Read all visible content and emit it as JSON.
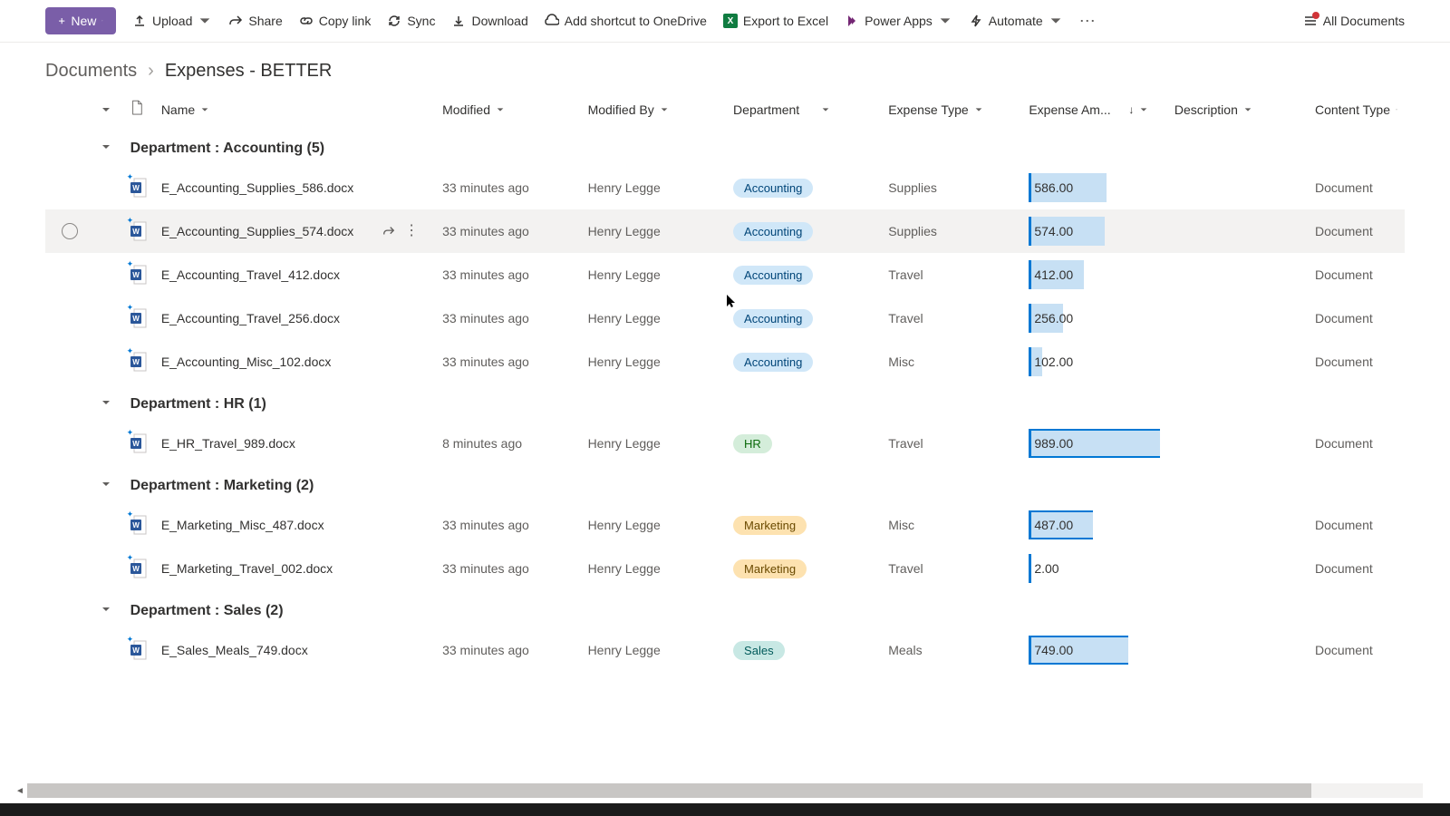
{
  "toolbar": {
    "new": "New",
    "upload": "Upload",
    "share": "Share",
    "copylink": "Copy link",
    "sync": "Sync",
    "download": "Download",
    "shortcut": "Add shortcut to OneDrive",
    "export": "Export to Excel",
    "powerapps": "Power Apps",
    "automate": "Automate",
    "alldocs": "All Documents"
  },
  "breadcrumb": {
    "root": "Documents",
    "current": "Expenses - BETTER"
  },
  "columns": {
    "name": "Name",
    "modified": "Modified",
    "modifiedby": "Modified By",
    "department": "Department",
    "exptype": "Expense Type",
    "amount": "Expense Am...",
    "description": "Description",
    "contenttype": "Content Type"
  },
  "groups": [
    {
      "label": "Department : Accounting (5)",
      "pillClass": "pill-acc",
      "items": [
        {
          "name": "E_Accounting_Supplies_586.docx",
          "modified": "33 minutes ago",
          "modby": "Henry Legge",
          "dept": "Accounting",
          "type": "Supplies",
          "amt": "586.00",
          "bar": 59,
          "ct": "Document"
        },
        {
          "name": "E_Accounting_Supplies_574.docx",
          "modified": "33 minutes ago",
          "modby": "Henry Legge",
          "dept": "Accounting",
          "type": "Supplies",
          "amt": "574.00",
          "bar": 58,
          "ct": "Document",
          "hover": true
        },
        {
          "name": "E_Accounting_Travel_412.docx",
          "modified": "33 minutes ago",
          "modby": "Henry Legge",
          "dept": "Accounting",
          "type": "Travel",
          "amt": "412.00",
          "bar": 42,
          "ct": "Document"
        },
        {
          "name": "E_Accounting_Travel_256.docx",
          "modified": "33 minutes ago",
          "modby": "Henry Legge",
          "dept": "Accounting",
          "type": "Travel",
          "amt": "256.00",
          "bar": 26,
          "ct": "Document"
        },
        {
          "name": "E_Accounting_Misc_102.docx",
          "modified": "33 minutes ago",
          "modby": "Henry Legge",
          "dept": "Accounting",
          "type": "Misc",
          "amt": "102.00",
          "bar": 10,
          "ct": "Document"
        }
      ]
    },
    {
      "label": "Department : HR (1)",
      "pillClass": "pill-hr",
      "items": [
        {
          "name": "E_HR_Travel_989.docx",
          "modified": "8 minutes ago",
          "modby": "Henry Legge",
          "dept": "HR",
          "type": "Travel",
          "amt": "989.00",
          "bar": 100,
          "big": true,
          "ct": "Document"
        }
      ]
    },
    {
      "label": "Department : Marketing (2)",
      "pillClass": "pill-mkt",
      "items": [
        {
          "name": "E_Marketing_Misc_487.docx",
          "modified": "33 minutes ago",
          "modby": "Henry Legge",
          "dept": "Marketing",
          "type": "Misc",
          "amt": "487.00",
          "bar": 49,
          "big": true,
          "ct": "Document"
        },
        {
          "name": "E_Marketing_Travel_002.docx",
          "modified": "33 minutes ago",
          "modby": "Henry Legge",
          "dept": "Marketing",
          "type": "Travel",
          "amt": "2.00",
          "bar": 1,
          "ct": "Document"
        }
      ]
    },
    {
      "label": "Department : Sales (2)",
      "pillClass": "pill-sales",
      "items": [
        {
          "name": "E_Sales_Meals_749.docx",
          "modified": "33 minutes ago",
          "modby": "Henry Legge",
          "dept": "Sales",
          "type": "Meals",
          "amt": "749.00",
          "bar": 76,
          "big": true,
          "ct": "Document"
        }
      ]
    }
  ]
}
